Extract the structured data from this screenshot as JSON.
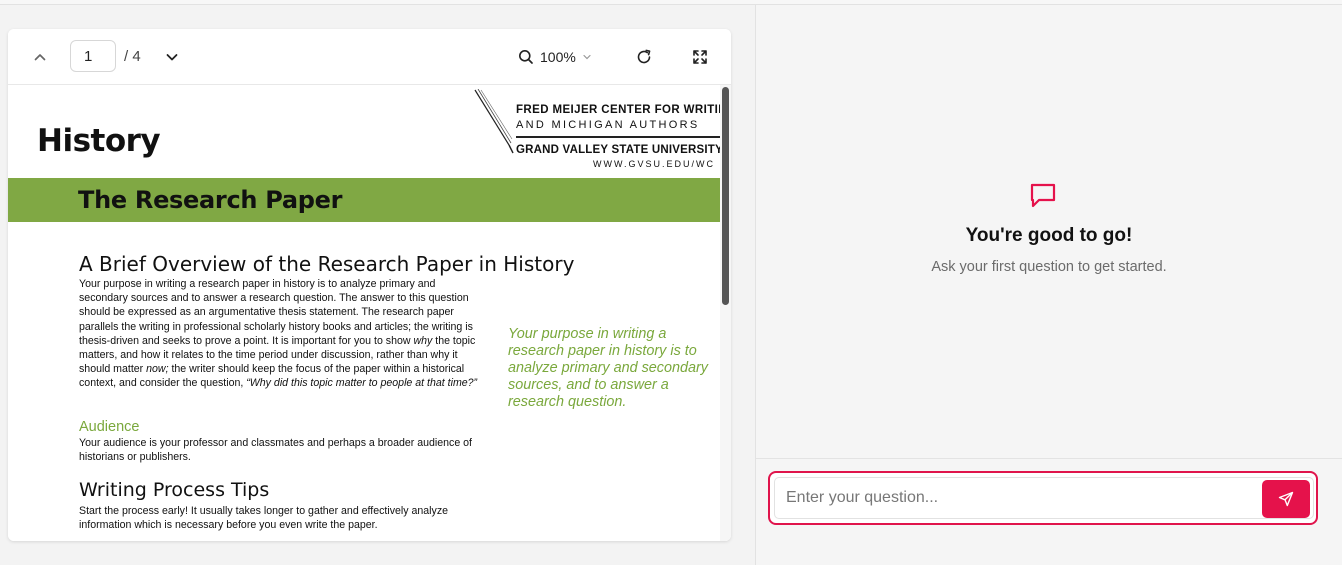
{
  "viewer": {
    "page": {
      "current": "1",
      "total": "/ 4"
    },
    "zoom": "100%",
    "icons": {
      "prev": "chevron-up-icon",
      "next": "chevron-down-icon",
      "zoom": "search-icon",
      "zoom_dropdown": "chevron-down-icon",
      "reload": "rotate-icon",
      "fullscreen": "expand-icon"
    }
  },
  "document": {
    "title": "History",
    "logo": {
      "line1": "FRED MEIJER CENTER FOR WRITING",
      "line2": "AND MICHIGAN AUTHORS",
      "line3": "GRAND VALLEY STATE UNIVERSITY",
      "line4": "WWW.GVSU.EDU/WC"
    },
    "banner": "The Research Paper",
    "overview_heading": "A Brief Overview of the Research Paper in History",
    "overview_parts": [
      "Your purpose in writing a research paper in history is to analyze primary and secondary sources and to answer a research question. The answer to this question should be expressed as an argumentative thesis statement. The research paper parallels the writing in professional scholarly history books and articles; the writing is thesis-driven and seeks to prove a point. It is important for you to show ",
      "why",
      " the topic matters, and how it relates to the time period under discussion, rather than why it should matter ",
      "now;",
      " the writer should keep the focus of the paper within a historical context, and consider the question, ",
      "“Why did this topic matter to people at that time?”"
    ],
    "pull_quote": "Your purpose in writing a research paper in history is to analyze primary and secondary sources, and to answer a research question.",
    "audience_heading": "Audience",
    "audience_text": "Your audience is your professor and classmates and perhaps a broader audience of historians or publishers.",
    "tips_heading": "Writing Process Tips",
    "tips_text": "Start the process early! It usually takes longer to gather and effectively analyze information which is necessary before you even write the paper."
  },
  "chat": {
    "empty_title": "You're good to go!",
    "empty_subtitle": "Ask your first question to get started.",
    "input_placeholder": "Enter your question...",
    "input_value": "",
    "accent_color": "#e5124b",
    "icons": {
      "empty": "message-square-icon",
      "send": "send-icon"
    }
  },
  "colors": {
    "banner": "#80a844",
    "pull_quote": "#7aa83c"
  }
}
